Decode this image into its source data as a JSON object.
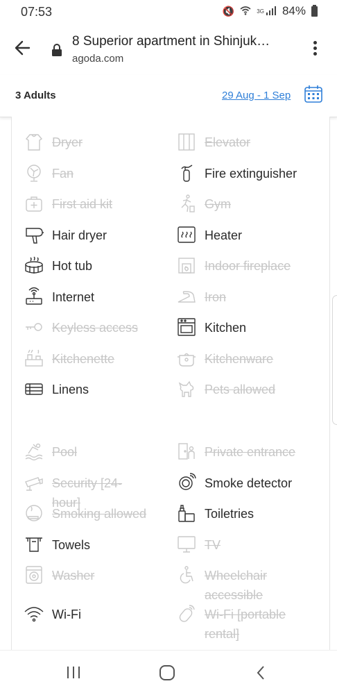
{
  "status": {
    "time": "07:53",
    "network": "3G",
    "battery": "84%"
  },
  "browser": {
    "title": "8 Superior apartment in Shinjuk…",
    "domain": "agoda.com"
  },
  "booking": {
    "guests": "3 Adults",
    "dates": "29 Aug - 1 Sep"
  },
  "amenities": [
    {
      "label": "Dryer",
      "available": false,
      "icon": "dryer-icon"
    },
    {
      "label": "Elevator",
      "available": false,
      "icon": "elevator-icon"
    },
    {
      "label": "Fan",
      "available": false,
      "icon": "fan-icon"
    },
    {
      "label": "Fire extinguisher",
      "available": true,
      "icon": "fire-extinguisher-icon"
    },
    {
      "label": "First aid kit",
      "available": false,
      "icon": "first-aid-icon"
    },
    {
      "label": "Gym",
      "available": false,
      "icon": "gym-icon"
    },
    {
      "label": "Hair dryer",
      "available": true,
      "icon": "hair-dryer-icon"
    },
    {
      "label": "Heater",
      "available": true,
      "icon": "heater-icon"
    },
    {
      "label": "Hot tub",
      "available": true,
      "icon": "hot-tub-icon"
    },
    {
      "label": "Indoor fireplace",
      "available": false,
      "icon": "fireplace-icon"
    },
    {
      "label": "Internet",
      "available": true,
      "icon": "router-icon"
    },
    {
      "label": "Iron",
      "available": false,
      "icon": "iron-icon"
    },
    {
      "label": "Keyless access",
      "available": false,
      "icon": "key-icon"
    },
    {
      "label": "Kitchen",
      "available": true,
      "icon": "oven-icon"
    },
    {
      "label": "Kitchenette",
      "available": false,
      "icon": "kitchenette-icon"
    },
    {
      "label": "Kitchenware",
      "available": false,
      "icon": "pot-icon"
    },
    {
      "label": "Linens",
      "available": true,
      "icon": "linens-icon"
    },
    {
      "label": "Pets allowed",
      "available": false,
      "icon": "pet-icon"
    },
    {
      "label": "Pool",
      "available": false,
      "icon": "pool-icon"
    },
    {
      "label": "Private entrance",
      "available": false,
      "icon": "door-icon"
    },
    {
      "label": "Security [24-",
      "label2": "hour]",
      "available": false,
      "icon": "camera-icon"
    },
    {
      "label": "Smoke detector",
      "available": true,
      "icon": "smoke-detector-icon"
    },
    {
      "label": "Smoking allowed",
      "available": false,
      "icon": "smoking-icon"
    },
    {
      "label": "Toiletries",
      "available": true,
      "icon": "toiletries-icon"
    },
    {
      "label": "Towels",
      "available": true,
      "icon": "towel-icon"
    },
    {
      "label": "TV",
      "available": false,
      "icon": "tv-icon"
    },
    {
      "label": "Washer",
      "available": false,
      "icon": "washer-icon"
    },
    {
      "label": "Wheelchair",
      "label2": "accessible",
      "available": false,
      "icon": "wheelchair-icon"
    },
    {
      "label": "Wi-Fi",
      "available": true,
      "icon": "wifi-icon"
    },
    {
      "label": "Wi-Fi [portable",
      "label2": "rental]",
      "available": false,
      "icon": "portable-wifi-icon"
    }
  ]
}
